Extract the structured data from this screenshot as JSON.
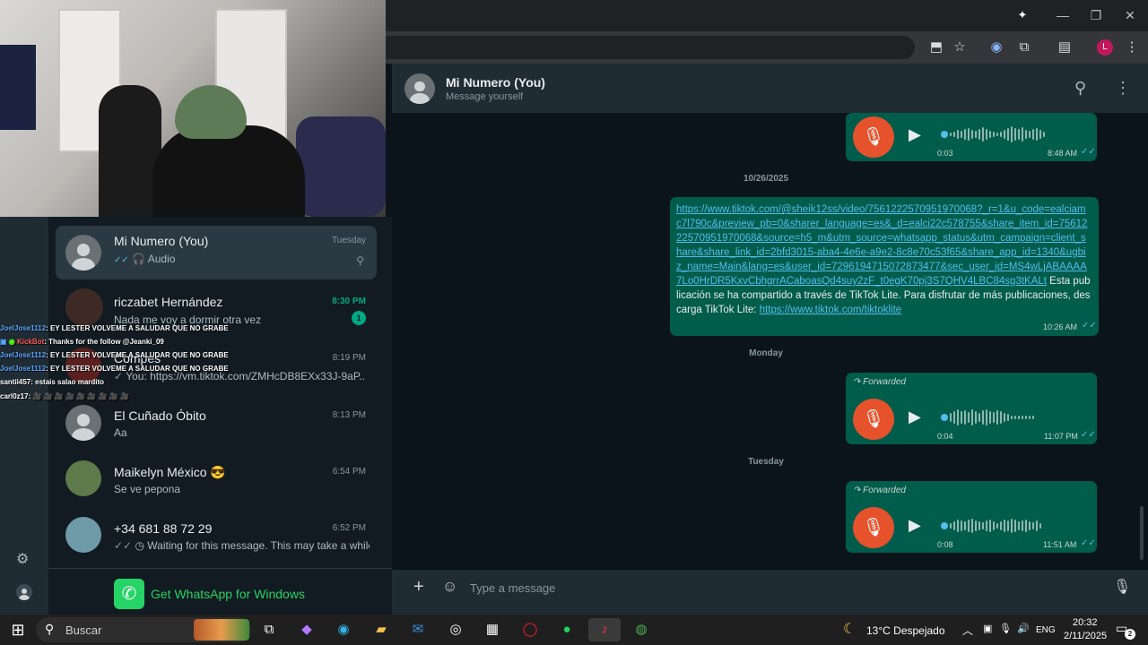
{
  "browser": {
    "window_controls": {
      "minimize": "—",
      "maximize": "❐",
      "close": "✕"
    }
  },
  "chat_list": {
    "items": [
      {
        "name": "Mi Numero (You)",
        "preview": "Audio",
        "time": "Tuesday",
        "pinned": true,
        "active": true
      },
      {
        "name": "riczabet Hernández",
        "preview": "Nada me voy a dormir otra vez",
        "time": "8:30 PM",
        "unread": "1"
      },
      {
        "name": "Compes",
        "preview": "You: https://vm.tiktok.com/ZMHcDB8EXx33J-9aP...",
        "time": "8:19 PM"
      },
      {
        "name": "El Cuñado Óbito",
        "preview": "Aa",
        "time": "8:13 PM"
      },
      {
        "name": "Maikelyn México 😎",
        "preview": "Se ve pepona",
        "time": "6:54 PM"
      },
      {
        "name": "+34 681 88 72 29",
        "preview": "Waiting for this message. This may take a while.",
        "time": "6:52 PM"
      }
    ],
    "get_whatsapp": "Get WhatsApp for Windows"
  },
  "stream_chat": [
    {
      "user": "JoelJose1112",
      "text": ": EY LESTER VOLVEME A SALUDAR QUE NO GRABE"
    },
    {
      "user": "KickBot",
      "text": ": Thanks for the follow @Jeanki_09"
    },
    {
      "user": "JoelJose1112",
      "text": ": EY LESTER VOLVEME A SALUDAR QUE NO GRABE"
    },
    {
      "user": "JoelJose1112",
      "text": ": EY LESTER VOLVEME A SALUDAR QUE NO GRABE"
    },
    {
      "user": "santii457",
      "text": ": estais salao mardito"
    },
    {
      "user": "carl0z17",
      "text": ": 🎥 🎥 🎥 🎥 🎥 🎥 🎥 🎥 🎥"
    }
  ],
  "chat": {
    "title": "Mi Numero (You)",
    "subtitle": "Message yourself",
    "messages": [
      {
        "type": "audio",
        "duration": "0:03",
        "time": "8:48 AM"
      },
      {
        "type": "date",
        "label": "10/26/2025"
      },
      {
        "type": "link",
        "url": "https://www.tiktok.com/@sheik12ss/video/7561222570951970068?_r=1&u_code=ealciamc7l790c&preview_pb=0&sharer_language=es&_d=ealci22c578755&share_item_id=7561222570951970068&source=h5_m&utm_source=whatsapp_status&utm_campaign=client_share&share_link_id=2bfd3015-aba4-4e6e-a9e2-8c8e70c53f65&share_app_id=1340&ugbiz_name=Main&lang=es&user_id=7296194715072873477&sec_user_id=MS4wLjABAAAA7Lo0HrDR5KxvCbhgrrACaboasQd4suy2zF_t0egK70pj3S7QHV4LBC84sg3tKALt",
        "text": " Esta publicación se ha compartido a través de TikTok Lite. Para disfrutar de más publicaciones, descarga TikTok Lite: ",
        "url2": "https://www.tiktok.com/tiktoklite",
        "time": "10:26 AM"
      },
      {
        "type": "date",
        "label": "Monday"
      },
      {
        "type": "audio",
        "forwarded": "Forwarded",
        "duration": "0:04",
        "time": "11:07 PM"
      },
      {
        "type": "date",
        "label": "Tuesday"
      },
      {
        "type": "audio",
        "forwarded": "Forwarded",
        "duration": "0:08",
        "time": "11:51 AM"
      }
    ],
    "composer_placeholder": "Type a message"
  },
  "taskbar": {
    "search": "Buscar",
    "weather": "13°C  Despejado",
    "lang": "ENG",
    "time": "20:32",
    "date": "2/11/2025",
    "notifications": "2"
  },
  "colors": {
    "accent": "#00a884",
    "bubble": "#005c4b",
    "mic": "#e5522c"
  }
}
